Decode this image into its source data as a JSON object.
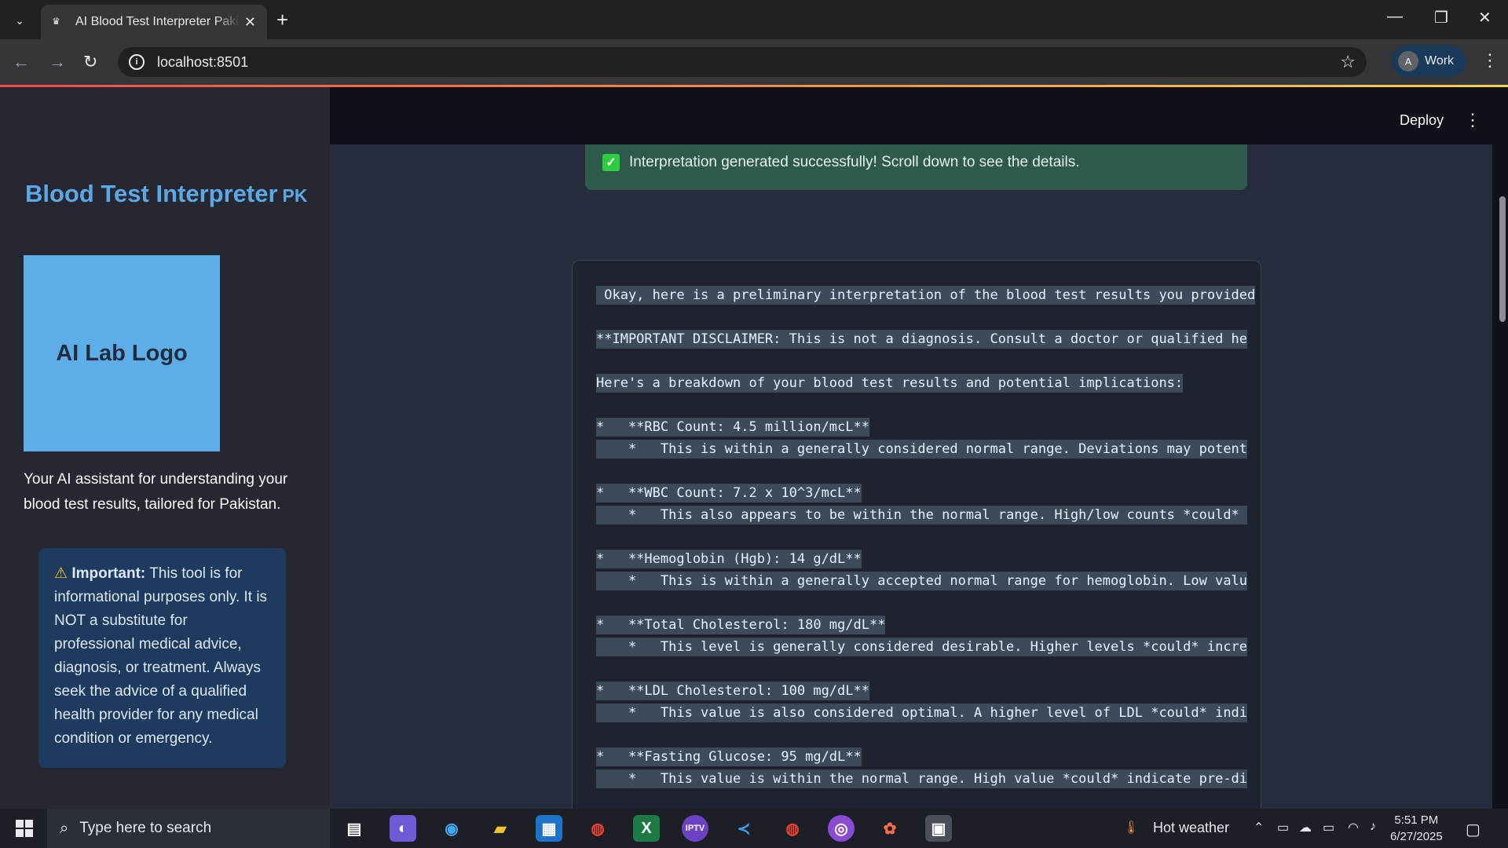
{
  "browser": {
    "tab_title": "AI Blood Test Interpreter Pakistan",
    "url": "localhost:8501",
    "profile_initial": "A",
    "profile_label": "Work"
  },
  "app": {
    "deploy_label": "Deploy"
  },
  "sidebar": {
    "title": "Blood Test Interpreter",
    "title_suffix": "PK",
    "logo_text": "AI Lab Logo",
    "description": "Your AI assistant for understanding your blood test results, tailored for Pakistan.",
    "warning_bold": "Important:",
    "warning_text": "This tool is for informational purposes only. It is NOT a substitute for professional medical advice, diagnosis, or treatment. Always seek the advice of a qualified health provider for any medical condition or emergency."
  },
  "main": {
    "success_message": "Interpretation generated successfully! Scroll down to see the details.",
    "lines": [
      " Okay, here is a preliminary interpretation of the blood test results you provided",
      "",
      "**IMPORTANT DISCLAIMER: This is not a diagnosis. Consult a doctor or qualified he",
      "",
      "Here's a breakdown of your blood test results and potential implications:",
      "",
      "*   **RBC Count: 4.5 million/mcL**",
      "    *   This is within a generally considered normal range. Deviations may potent",
      "",
      "*   **WBC Count: 7.2 x 10^3/mcL**",
      "    *   This also appears to be within the normal range. High/low counts *could* ",
      "",
      "*   **Hemoglobin (Hgb): 14 g/dL**",
      "    *   This is within a generally accepted normal range for hemoglobin. Low valu",
      "",
      "*   **Total Cholesterol: 180 mg/dL**",
      "    *   This level is generally considered desirable. Higher levels *could* incre",
      "",
      "*   **LDL Cholesterol: 100 mg/dL**",
      "    *   This value is also considered optimal. A higher level of LDL *could* indi",
      "",
      "*   **Fasting Glucose: 95 mg/dL**",
      "    *   This value is within the normal range. High value *could* indicate pre-di"
    ]
  },
  "taskbar": {
    "search_placeholder": "Type here to search",
    "weather": "Hot weather",
    "time": "5:51 PM",
    "date": "6/27/2025"
  }
}
